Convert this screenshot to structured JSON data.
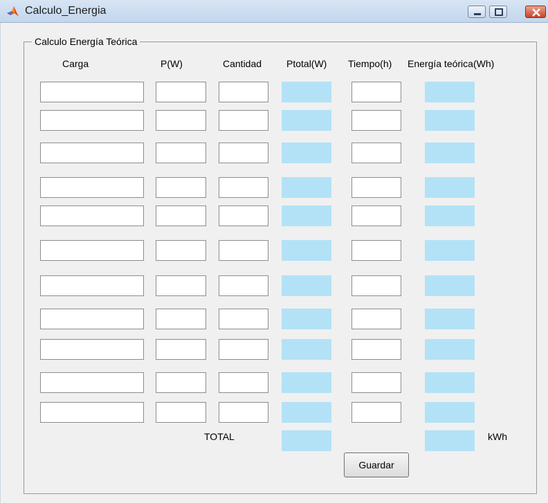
{
  "window": {
    "title": "Calculo_Energia",
    "controls": [
      "minimize-icon",
      "maximize-icon",
      "close-icon"
    ]
  },
  "panel": {
    "title": "Calculo Energía Teórica",
    "headers": {
      "carga": "Carga",
      "potencia": "P(W)",
      "cantidad": "Cantidad",
      "ptotal": "Ptotal(W)",
      "tiempo": "Tiempo(h)",
      "energia": "Energía teórica(Wh)"
    },
    "row_count": 11,
    "rows": [
      {
        "carga": "",
        "potencia": "",
        "cantidad": "",
        "ptotal": "",
        "tiempo": "",
        "energia": ""
      },
      {
        "carga": "",
        "potencia": "",
        "cantidad": "",
        "ptotal": "",
        "tiempo": "",
        "energia": ""
      },
      {
        "carga": "",
        "potencia": "",
        "cantidad": "",
        "ptotal": "",
        "tiempo": "",
        "energia": ""
      },
      {
        "carga": "",
        "potencia": "",
        "cantidad": "",
        "ptotal": "",
        "tiempo": "",
        "energia": ""
      },
      {
        "carga": "",
        "potencia": "",
        "cantidad": "",
        "ptotal": "",
        "tiempo": "",
        "energia": ""
      },
      {
        "carga": "",
        "potencia": "",
        "cantidad": "",
        "ptotal": "",
        "tiempo": "",
        "energia": ""
      },
      {
        "carga": "",
        "potencia": "",
        "cantidad": "",
        "ptotal": "",
        "tiempo": "",
        "energia": ""
      },
      {
        "carga": "",
        "potencia": "",
        "cantidad": "",
        "ptotal": "",
        "tiempo": "",
        "energia": ""
      },
      {
        "carga": "",
        "potencia": "",
        "cantidad": "",
        "ptotal": "",
        "tiempo": "",
        "energia": ""
      },
      {
        "carga": "",
        "potencia": "",
        "cantidad": "",
        "ptotal": "",
        "tiempo": "",
        "energia": ""
      },
      {
        "carga": "",
        "potencia": "",
        "cantidad": "",
        "ptotal": "",
        "tiempo": "",
        "energia": ""
      }
    ],
    "total_label": "TOTAL",
    "total_ptotal": "",
    "total_energia": "",
    "unit_label": "kWh",
    "save_label": "Guardar"
  },
  "colors": {
    "output_field": "#b3e2f7",
    "input_field": "#ffffff",
    "background": "#f0f0f0"
  }
}
